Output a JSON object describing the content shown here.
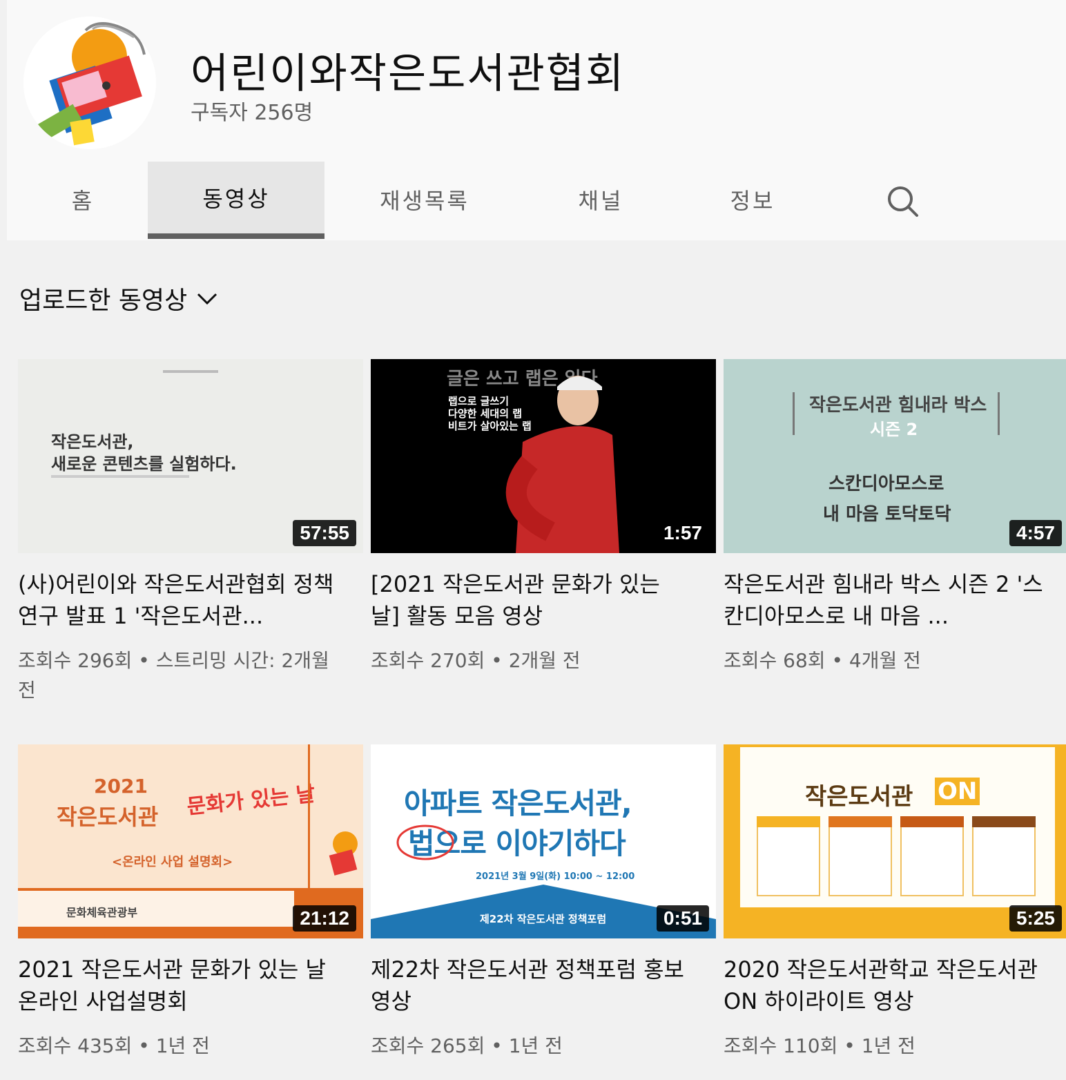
{
  "channel": {
    "name": "어린이와작은도서관협회",
    "subscribers": "구독자 256명"
  },
  "tabs": [
    {
      "label": "홈",
      "active": false
    },
    {
      "label": "동영상",
      "active": true
    },
    {
      "label": "재생목록",
      "active": false
    },
    {
      "label": "채널",
      "active": false
    },
    {
      "label": "정보",
      "active": false
    }
  ],
  "section": {
    "title": "업로드한 동영상"
  },
  "videos": [
    {
      "title": "(사)어린이와 작은도서관협회 정책연구 발표 1 '작은도서관...",
      "meta": "조회수 296회 • 스트리밍 시간: 2개월 전",
      "duration": "57:55",
      "thumb_text": [
        "작은도서관,",
        "새로운 콘텐츠를 실험하다."
      ]
    },
    {
      "title": "[2021 작은도서관 문화가 있는 날] 활동 모음 영상",
      "meta": "조회수 270회 • 2개월 전",
      "duration": "1:57",
      "thumb_text": [
        "글은 쓰고 랩은 읽다",
        "랩으로 글쓰기",
        "다양한 세대의 랩",
        "비트가 살아있는 랩"
      ]
    },
    {
      "title": "작은도서관 힘내라 박스 시즌 2 '스칸디아모스로 내 마음 ...",
      "meta": "조회수 68회 • 4개월 전",
      "duration": "4:57",
      "thumb_text": [
        "작은도서관 힘내라 박스",
        "시즌 2",
        "스칸디아모스로",
        "내 마음 토닥토닥"
      ]
    },
    {
      "title": "2021 작은도서관 문화가 있는 날 온라인 사업설명회",
      "meta": "조회수 435회 • 1년 전",
      "duration": "21:12",
      "thumb_text": [
        "2021",
        "작은도서관",
        "문화가 있는 날",
        "<온라인 사업 설명회>",
        "문화체육관광부"
      ]
    },
    {
      "title": "제22차 작은도서관 정책포럼 홍보 영상",
      "meta": "조회수 265회 • 1년 전",
      "duration": "0:51",
      "thumb_text": [
        "아파트 작은도서관,",
        "법으로 이야기하다",
        "2021년 3월 9일(화) 10:00 ~ 12:00",
        "제22차 작은도서관 정책포럼"
      ]
    },
    {
      "title": "2020 작은도서관학교 작은도서관 ON 하이라이트 영상",
      "meta": "조회수 110회 • 1년 전",
      "duration": "5:25",
      "thumb_text": [
        "작은도서관",
        "ON"
      ]
    }
  ],
  "colors": {
    "page_bg": "#f1f1f1",
    "header_bg": "#f9f9f9",
    "text_primary": "#0f0f0f",
    "text_secondary": "#606060",
    "active_tab_bg": "#e6e6e6"
  }
}
